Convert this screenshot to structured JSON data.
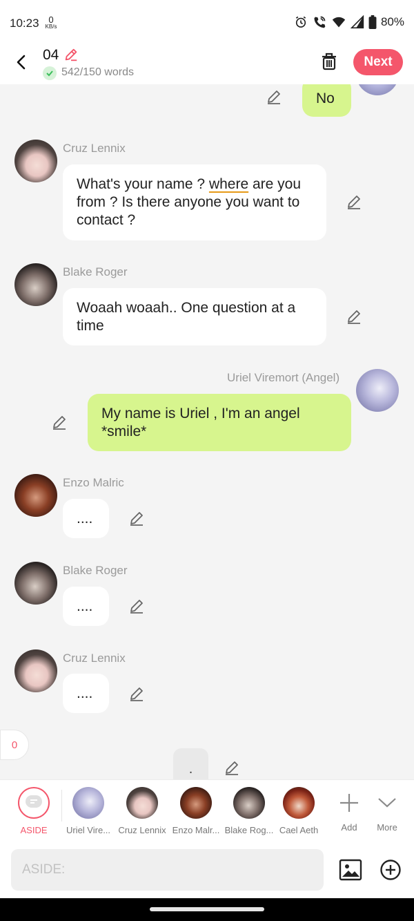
{
  "status": {
    "time": "10:23",
    "net_speed": "0",
    "net_unit": "KB/s",
    "battery": "80%"
  },
  "header": {
    "title": "04",
    "word_count": "542/150 words",
    "next_label": "Next"
  },
  "messages": [
    {
      "text": "No"
    },
    {
      "name": "Cruz Lennix",
      "text_a": "What's your name ? ",
      "text_b": "where",
      "text_c": " are you from ? Is there anyone you want to contact ?"
    },
    {
      "name": "Blake Roger",
      "text": "Woaah woaah.. One question at a time"
    },
    {
      "name": "Uriel Viremort (Angel)",
      "text": "My name is Uriel , I'm an angel *smile*"
    },
    {
      "name": "Enzo Malric",
      "text": "...."
    },
    {
      "name": "Blake Roger",
      "text": "...."
    },
    {
      "name": "Cruz Lennix",
      "text": "...."
    },
    {
      "text": "."
    }
  ],
  "counter": "0",
  "characters": [
    {
      "label": "ASIDE"
    },
    {
      "label": "Uriel Vire..."
    },
    {
      "label": "Cruz Lennix"
    },
    {
      "label": "Enzo Malr..."
    },
    {
      "label": "Blake Rog..."
    },
    {
      "label": "Cael Aeth"
    },
    {
      "label": "Add"
    },
    {
      "label": "More"
    }
  ],
  "input": {
    "placeholder": "ASIDE:"
  },
  "colors": {
    "accent": "#f4566b",
    "my_bubble": "#d7f58e",
    "bubble": "#ffffff",
    "background": "#f4f4f4"
  },
  "icons": [
    "back-arrow-icon",
    "pencil-edit-icon",
    "check-icon",
    "trash-icon",
    "alarm-icon",
    "call-wifi-icon",
    "wifi-icon",
    "signal-icon",
    "battery-icon",
    "aside-chat-icon",
    "plus-icon",
    "chevron-down-icon",
    "image-icon",
    "add-circle-icon"
  ]
}
